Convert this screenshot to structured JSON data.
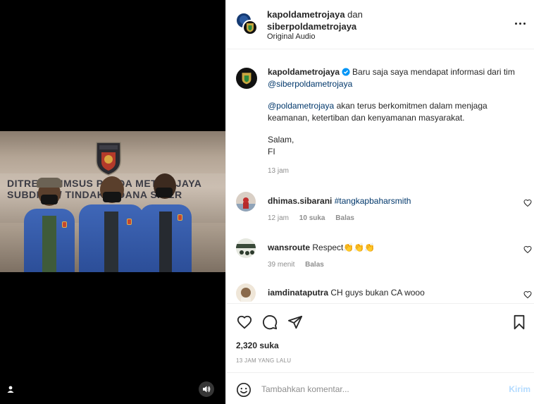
{
  "header": {
    "user1": "kapoldametrojaya",
    "joiner": "dan",
    "user2": "siberpoldametrojaya",
    "audio": "Original Audio"
  },
  "caption": {
    "username": "kapoldametrojaya",
    "line1": "Baru saja saya mendapat informasi dari tim",
    "mention1": "@siberpoldametrojaya",
    "mention2": "@poldametrojaya",
    "para2": "akan terus berkomitmen dalam menjaga keamanan, ketertiban dan kenyamanan masyarakat.",
    "sign1": "Salam,",
    "sign2": "FI",
    "time": "13 jam"
  },
  "comments": [
    {
      "username": "dhimas.sibarani",
      "text": "#tangkapbaharsmith",
      "time": "12 jam",
      "likes": "10 suka",
      "reply": "Balas"
    },
    {
      "username": "wansroute",
      "text": "Respect👏👏👏",
      "time": "39 menit",
      "reply": "Balas"
    },
    {
      "username": "iamdinataputra",
      "text": "CH guys bukan CA wooo"
    }
  ],
  "photo_text": {
    "line1": "DITRESKRIMSUS POLDA METRO JAYA",
    "line2": "SUBDIT V / TINDAK PIDANA SIBER"
  },
  "stats": {
    "likes": "2,320 suka",
    "posted": "13 JAM YANG LALU"
  },
  "composer": {
    "placeholder": "Tambahkan komentar...",
    "post": "Kirim"
  },
  "icons": {
    "more": "more-horizontal-icon",
    "like": "heart-icon",
    "comment": "comment-icon",
    "share": "send-icon",
    "save": "bookmark-icon",
    "emoji": "emoji-icon",
    "verified": "verified-badge-icon",
    "user_tag": "user-tag-icon",
    "sound": "speaker-icon"
  },
  "colors": {
    "mention": "#00376b",
    "verified": "#0095f6",
    "muted": "#8e8e8e",
    "post_disabled": "#b3dbff"
  }
}
